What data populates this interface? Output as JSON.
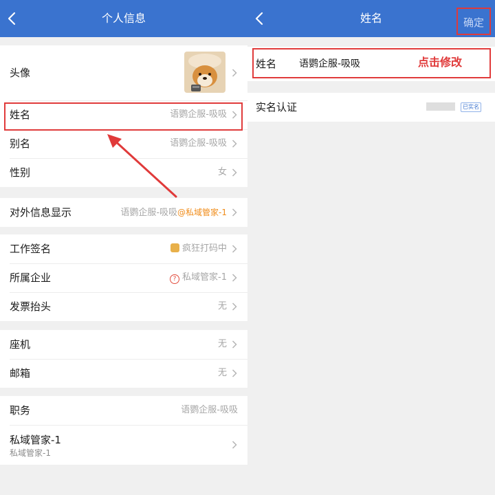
{
  "left": {
    "title": "个人信息",
    "groups": [
      {
        "rows": [
          {
            "label": "头像",
            "value": ""
          },
          {
            "label": "姓名",
            "value": "语鹦企服-吸吸"
          },
          {
            "label": "别名",
            "value": "语鹦企服-吸吸"
          },
          {
            "label": "性别",
            "value": "女"
          }
        ]
      },
      {
        "rows": [
          {
            "label": "对外信息显示",
            "value": "语鹦企服-吸吸",
            "suffix": "@私域管家-1"
          }
        ]
      },
      {
        "rows": [
          {
            "label": "工作签名",
            "value": "疯狂打码中",
            "icon": "coder-emoji-icon"
          },
          {
            "label": "所属企业",
            "value": "私域管家-1",
            "icon": "question-circle-icon"
          },
          {
            "label": "发票抬头",
            "value": "无"
          }
        ]
      },
      {
        "rows": [
          {
            "label": "座机",
            "value": "无"
          },
          {
            "label": "邮箱",
            "value": "无"
          }
        ]
      },
      {
        "rows": [
          {
            "label": "职务",
            "value": "语鹦企服-吸吸"
          },
          {
            "label": "私域管家-1",
            "sublabel": "私域管家-1",
            "value": ""
          }
        ]
      }
    ]
  },
  "right": {
    "title": "姓名",
    "confirm": "确定",
    "name_label": "姓名",
    "name_value": "语鹦企服-吸吸",
    "annotation": "点击修改",
    "realname_label": "实名认证",
    "realname_badge": "已实名"
  },
  "colors": {
    "nav": "#3a73cf",
    "highlight": "#e03a3a",
    "annotation": "#e03a3a",
    "suffix": "#f08c1a"
  }
}
